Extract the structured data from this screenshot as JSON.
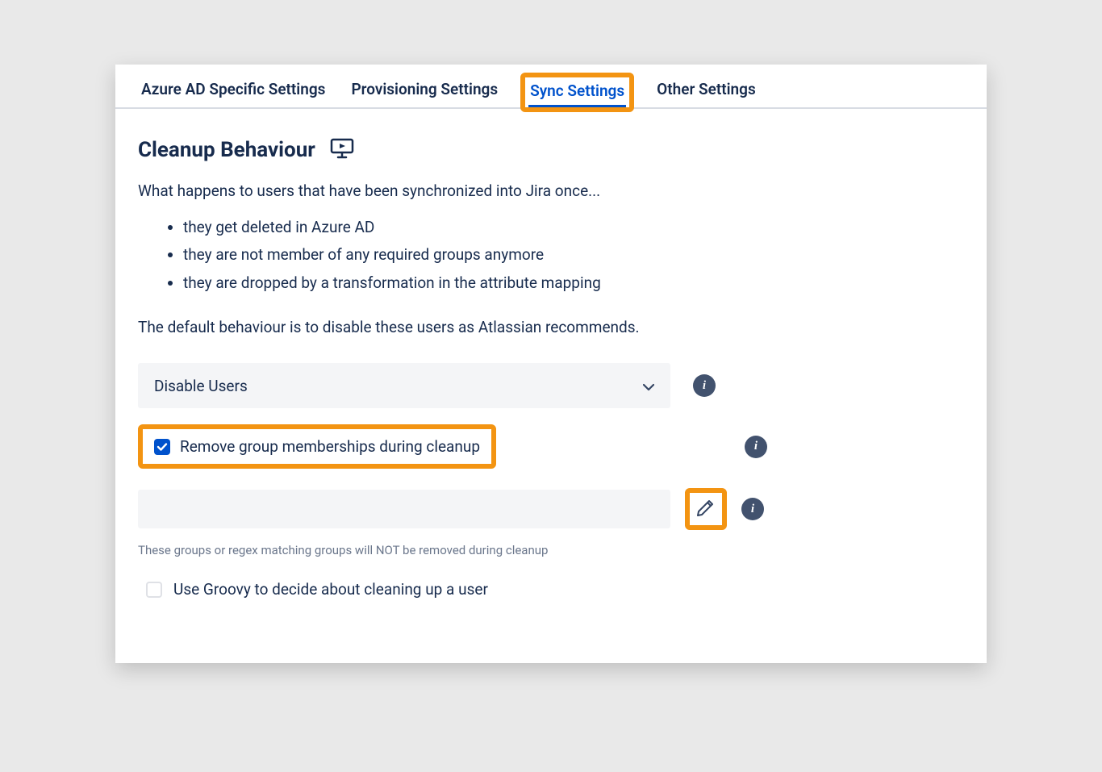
{
  "tabs": {
    "azure": "Azure AD Specific Settings",
    "provisioning": "Provisioning Settings",
    "sync": "Sync Settings",
    "other": "Other Settings",
    "active": "sync"
  },
  "section": {
    "title": "Cleanup Behaviour",
    "intro": "What happens to users that have been synchronized into Jira once...",
    "bullets": [
      "they get deleted in Azure AD",
      "they are not member of any required groups anymore",
      "they are dropped by a transformation in the attribute mapping"
    ],
    "default_note": "The default behaviour is to disable these users as Atlassian recommends."
  },
  "dropdown": {
    "selected": "Disable Users"
  },
  "remove_groups": {
    "label": "Remove group memberships during cleanup",
    "checked": true
  },
  "exclude_input": {
    "value": "",
    "helper": "These groups or regex matching groups will NOT be removed during cleanup"
  },
  "groovy": {
    "label": "Use Groovy to decide about cleaning up a user",
    "checked": false
  },
  "colors": {
    "highlight": "#f39412",
    "primary": "#0052cc",
    "text": "#172b4d"
  }
}
